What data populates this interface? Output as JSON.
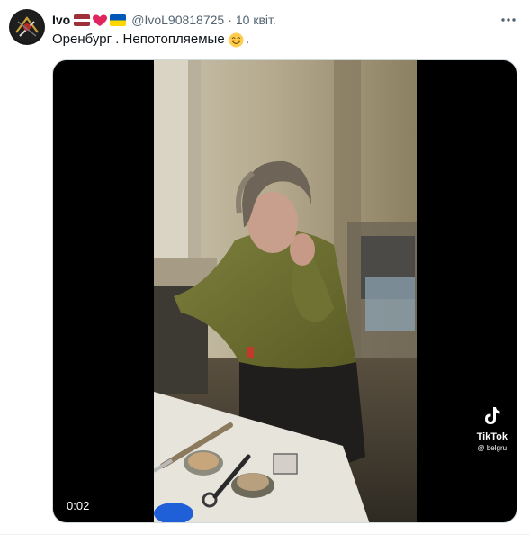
{
  "tweet": {
    "author_name": "Ivo",
    "author_handle": "@IvoL90818725",
    "separator": "·",
    "date": "10 квіт.",
    "text": "Оренбург . Непотопляемые",
    "trailing_text": ".",
    "badges": [
      "latvia-flag",
      "red-heart",
      "ukraine-flag"
    ]
  },
  "media": {
    "kind": "video",
    "timestamp": "0:02",
    "watermark_title": "TikTok",
    "watermark_user": "@ belgru"
  },
  "colors": {
    "text_primary": "#0f1419",
    "text_secondary": "#536471",
    "media_background": "#000000",
    "latvia_red": "#9e3039",
    "ukraine_blue": "#0057b7",
    "ukraine_yellow": "#ffd700",
    "heart_red": "#e0245e"
  },
  "icons": {
    "more": "more-horizontal-icon",
    "emoji": "smiling-face-emoji"
  }
}
